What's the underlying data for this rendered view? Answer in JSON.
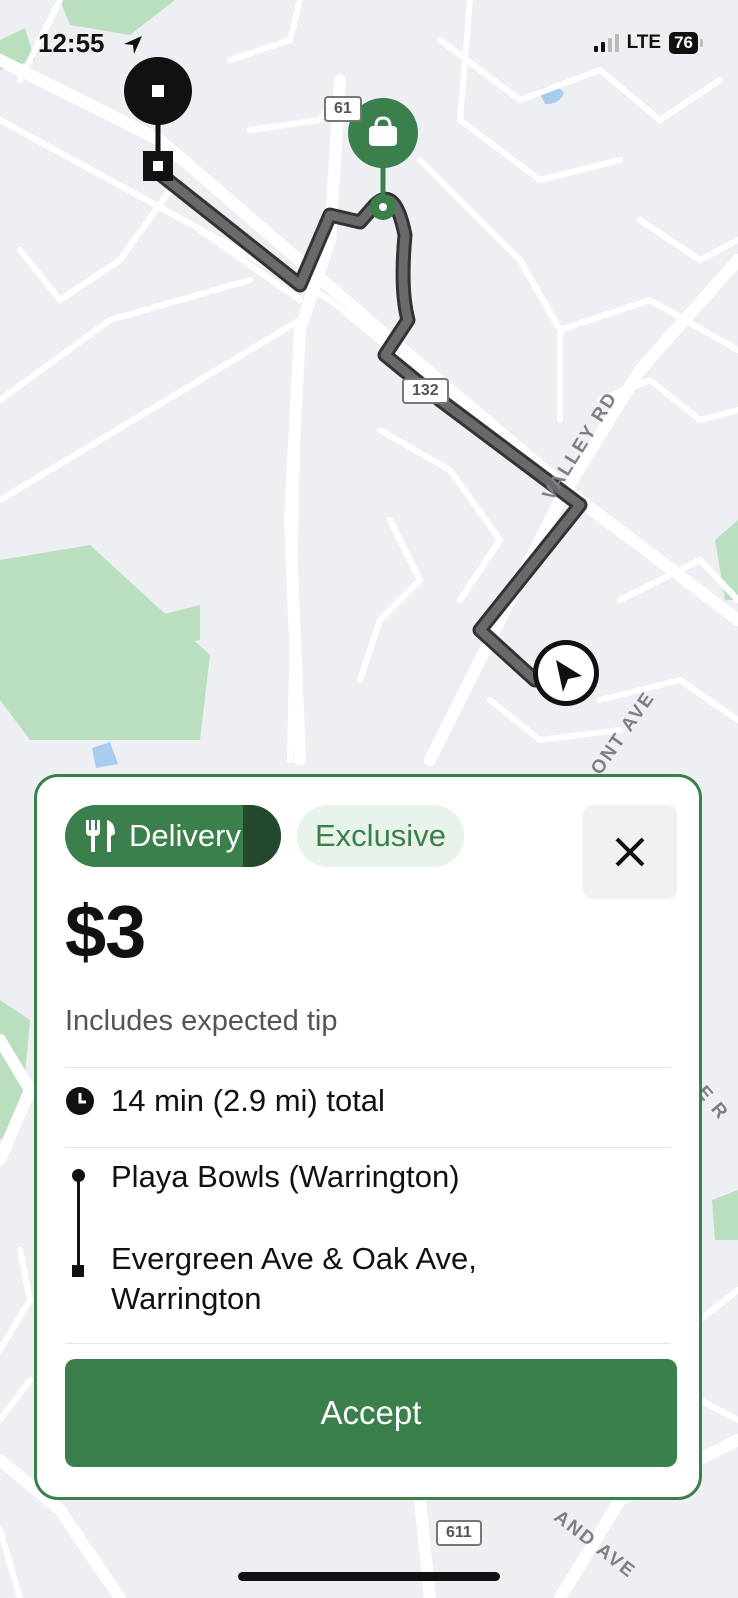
{
  "status_bar": {
    "time": "12:55",
    "network": "LTE",
    "battery": "76"
  },
  "map": {
    "road_labels": [
      "VALLEY RD",
      "ONT AVE",
      "E R",
      "AND AVE"
    ],
    "route_shields": [
      "61",
      "132",
      "611"
    ]
  },
  "card": {
    "delivery_label": "Delivery",
    "exclusive_label": "Exclusive",
    "price": "$3",
    "tip_note": "Includes expected tip",
    "trip_summary": "14 min (2.9 mi) total",
    "pickup": "Playa Bowls (Warrington)",
    "dropoff": "Evergreen Ave & Oak Ave, Warrington",
    "accept_label": "Accept"
  },
  "icons": [
    "location-arrow-icon",
    "fork-knife-icon",
    "close-icon",
    "clock-icon",
    "pickup-bag-icon",
    "dropoff-square-icon",
    "navigation-arrow-icon"
  ],
  "colors": {
    "accent": "#3a7f4c",
    "accent_dark": "#24492d",
    "accent_light": "#e8f3ea",
    "route": "#555555"
  }
}
